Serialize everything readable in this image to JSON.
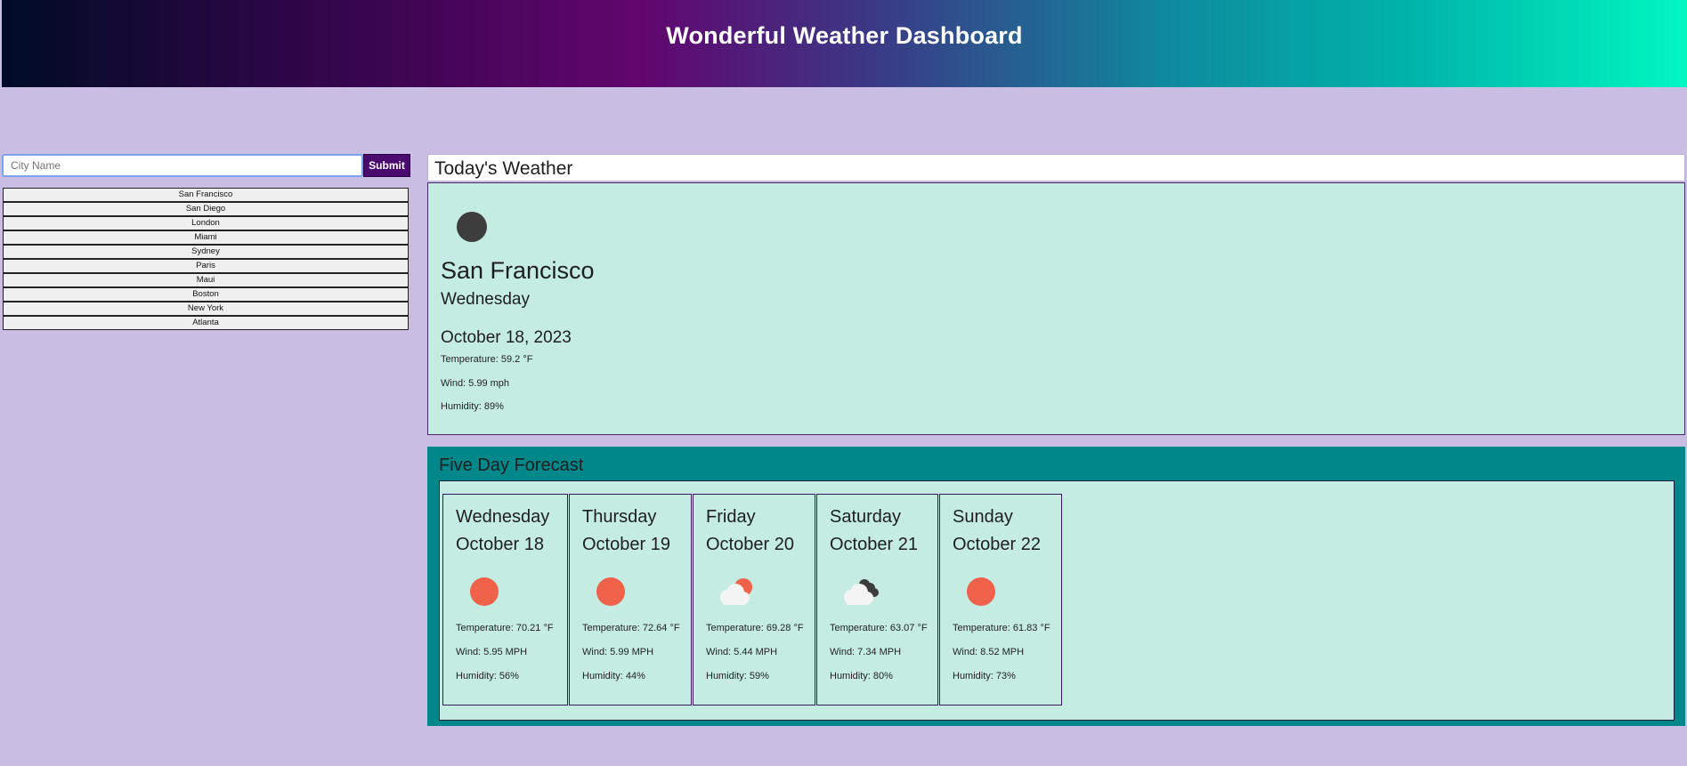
{
  "header": {
    "title": "Wonderful Weather Dashboard"
  },
  "search": {
    "placeholder": "City Name",
    "submit_label": "Submit"
  },
  "history": [
    "San Francisco",
    "San Diego",
    "London",
    "Miami",
    "Sydney",
    "Paris",
    "Maui",
    "Boston",
    "New York",
    "Atlanta"
  ],
  "today": {
    "title": "Today's Weather",
    "icon": "moon-icon",
    "city": "San Francisco",
    "weekday": "Wednesday",
    "date": "October 18, 2023",
    "temperature": "Temperature: 59.2 °F",
    "wind": "Wind: 5.99 mph",
    "humidity": "Humidity: 89%"
  },
  "forecast": {
    "title": "Five Day Forecast",
    "days": [
      {
        "day": "Wednesday",
        "date": "October 18",
        "icon": "sun-icon",
        "temperature": "Temperature: 70.21 °F",
        "wind": "Wind: 5.95 MPH",
        "humidity": "Humidity: 56%"
      },
      {
        "day": "Thursday",
        "date": "October 19",
        "icon": "sun-icon",
        "temperature": "Temperature: 72.64 °F",
        "wind": "Wind: 5.99 MPH",
        "humidity": "Humidity: 44%"
      },
      {
        "day": "Friday",
        "date": "October 20",
        "icon": "partly-cloudy-icon",
        "temperature": "Temperature: 69.28 °F",
        "wind": "Wind: 5.44 MPH",
        "humidity": "Humidity: 59%"
      },
      {
        "day": "Saturday",
        "date": "October 21",
        "icon": "cloudy-icon",
        "temperature": "Temperature: 63.07 °F",
        "wind": "Wind: 7.34 MPH",
        "humidity": "Humidity: 80%"
      },
      {
        "day": "Sunday",
        "date": "October 22",
        "icon": "sun-icon",
        "temperature": "Temperature: 61.83 °F",
        "wind": "Wind: 8.52 MPH",
        "humidity": "Humidity: 73%"
      }
    ]
  },
  "colors": {
    "page_bg": "#c9bde3",
    "card_bg": "#c5ece3",
    "forecast_bg": "#00878a",
    "submit_bg": "#4b0b6e",
    "sun": "#ef6149",
    "moon": "#3d3d3d"
  }
}
